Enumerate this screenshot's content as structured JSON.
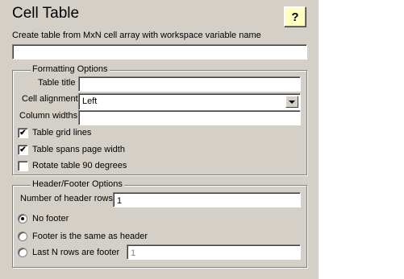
{
  "header": {
    "title": "Cell Table",
    "help_label": "?",
    "description": "Create table from MxN cell array with workspace variable name",
    "variable_name": ""
  },
  "formatting": {
    "legend": "Formatting Options",
    "table_title_label": "Table title",
    "table_title_value": "",
    "cell_alignment_label": "Cell alignment",
    "cell_alignment_value": "Left",
    "column_widths_label": "Column widths",
    "column_widths_value": "",
    "grid_lines_label": "Table grid lines",
    "grid_lines_checked": true,
    "spans_width_label": "Table spans page width",
    "spans_width_checked": true,
    "rotate_label": "Rotate table 90 degrees",
    "rotate_checked": false
  },
  "header_footer": {
    "legend": "Header/Footer Options",
    "header_rows_label": "Number of header rows",
    "header_rows_value": "1",
    "no_footer_label": "No footer",
    "same_as_header_label": "Footer is the same as header",
    "last_n_rows_label": "Last N rows are footer",
    "last_n_rows_value": "1",
    "selected_option": "no_footer"
  },
  "icons": {
    "check": "✔",
    "help": "help-icon",
    "dropdown": "chevron-down-icon"
  }
}
